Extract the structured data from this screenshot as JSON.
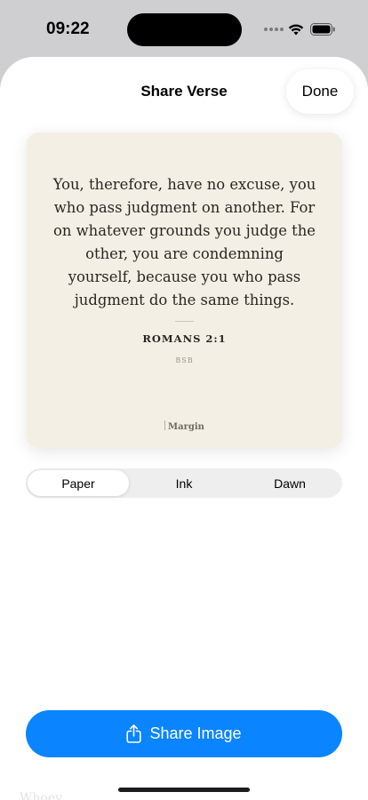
{
  "status_bar": {
    "time": "09:22",
    "icons": [
      "cellular-signal-icon",
      "wifi-icon",
      "battery-icon"
    ]
  },
  "sheet": {
    "title": "Share Verse",
    "done_label": "Done"
  },
  "card": {
    "verse_lines": [
      "You, therefore, have no excuse, you",
      "who pass judgment on another. For",
      "on whatever grounds you judge the",
      "other, you are condemning",
      "yourself, because you who pass",
      "judgment do the same things."
    ],
    "reference": "ROMANS 2:1",
    "translation": "BSB",
    "brand": "Margin",
    "background": "#f4efe4"
  },
  "theme_picker": {
    "options": [
      "Paper",
      "Ink",
      "Dawn"
    ],
    "selected": "Paper"
  },
  "share_button": {
    "label": "Share Image",
    "icon": "share-icon",
    "color": "#0a84ff"
  },
  "background_peek": "Whoev"
}
